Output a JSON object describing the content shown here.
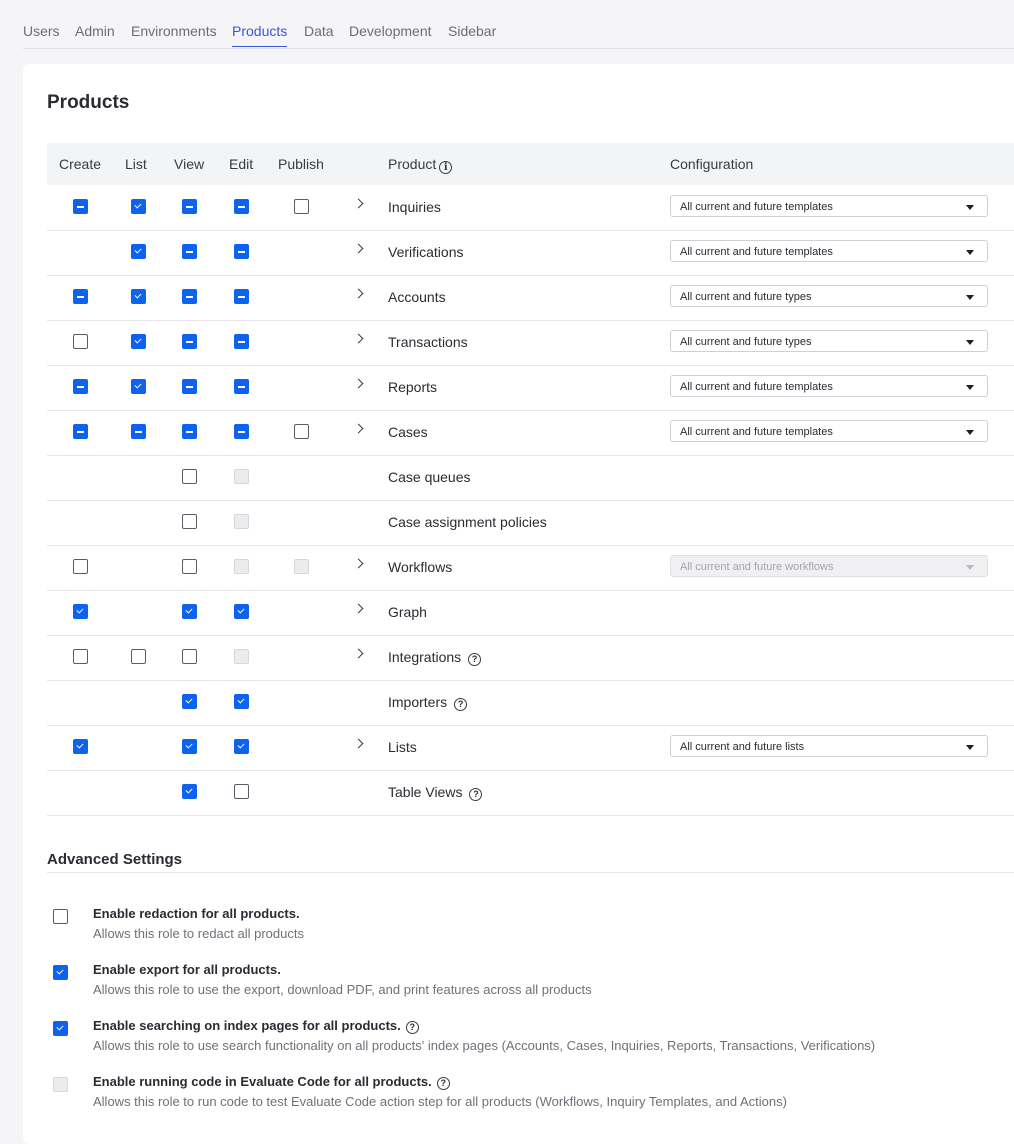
{
  "tabs": [
    "Users",
    "Admin",
    "Environments",
    "Products",
    "Data",
    "Development",
    "Sidebar"
  ],
  "active_tab": "Products",
  "page_title": "Products",
  "headers": {
    "create": "Create",
    "list": "List",
    "view": "View",
    "edit": "Edit",
    "publish": "Publish",
    "product": "Product",
    "configuration": "Configuration"
  },
  "colors": {
    "accent": "#0d62f0",
    "tab_active": "#3b55d9"
  },
  "rows": [
    {
      "name": "Inquiries",
      "create": "mixed",
      "list": "checked",
      "view": "mixed",
      "edit": "mixed",
      "publish": "unchecked",
      "expandable": true,
      "help": false,
      "config": "All current and future templates",
      "config_disabled": false
    },
    {
      "name": "Verifications",
      "create": "none",
      "list": "checked",
      "view": "mixed",
      "edit": "mixed",
      "publish": "none",
      "expandable": true,
      "help": false,
      "config": "All current and future templates",
      "config_disabled": false
    },
    {
      "name": "Accounts",
      "create": "mixed",
      "list": "checked",
      "view": "mixed",
      "edit": "mixed",
      "publish": "none",
      "expandable": true,
      "help": false,
      "config": "All current and future types",
      "config_disabled": false
    },
    {
      "name": "Transactions",
      "create": "unchecked",
      "list": "checked",
      "view": "mixed",
      "edit": "mixed",
      "publish": "none",
      "expandable": true,
      "help": false,
      "config": "All current and future types",
      "config_disabled": false
    },
    {
      "name": "Reports",
      "create": "mixed",
      "list": "checked",
      "view": "mixed",
      "edit": "mixed",
      "publish": "none",
      "expandable": true,
      "help": false,
      "config": "All current and future templates",
      "config_disabled": false
    },
    {
      "name": "Cases",
      "create": "mixed",
      "list": "mixed",
      "view": "mixed",
      "edit": "mixed",
      "publish": "unchecked",
      "expandable": true,
      "help": false,
      "config": "All current and future templates",
      "config_disabled": false
    },
    {
      "name": "Case queues",
      "create": "none",
      "list": "none",
      "view": "unchecked",
      "edit": "disabled",
      "publish": "none",
      "expandable": false,
      "help": false,
      "config": null,
      "config_disabled": false
    },
    {
      "name": "Case assignment policies",
      "create": "none",
      "list": "none",
      "view": "unchecked",
      "edit": "disabled",
      "publish": "none",
      "expandable": false,
      "help": false,
      "config": null,
      "config_disabled": false
    },
    {
      "name": "Workflows",
      "create": "unchecked",
      "list": "none",
      "view": "unchecked",
      "edit": "disabled",
      "publish": "disabled",
      "expandable": true,
      "help": false,
      "config": "All current and future workflows",
      "config_disabled": true
    },
    {
      "name": "Graph",
      "create": "checked",
      "list": "none",
      "view": "checked",
      "edit": "checked",
      "publish": "none",
      "expandable": true,
      "help": false,
      "config": null,
      "config_disabled": false
    },
    {
      "name": "Integrations",
      "create": "unchecked",
      "list": "unchecked",
      "view": "unchecked",
      "edit": "disabled",
      "publish": "none",
      "expandable": true,
      "help": true,
      "config": null,
      "config_disabled": false
    },
    {
      "name": "Importers",
      "create": "none",
      "list": "none",
      "view": "checked",
      "edit": "checked",
      "publish": "none",
      "expandable": false,
      "help": true,
      "config": null,
      "config_disabled": false
    },
    {
      "name": "Lists",
      "create": "checked",
      "list": "none",
      "view": "checked",
      "edit": "checked",
      "publish": "none",
      "expandable": true,
      "help": false,
      "config": "All current and future lists",
      "config_disabled": false
    },
    {
      "name": "Table Views",
      "create": "none",
      "list": "none",
      "view": "checked",
      "edit": "unchecked",
      "publish": "none",
      "expandable": false,
      "help": true,
      "config": null,
      "config_disabled": false
    }
  ],
  "advanced": {
    "title": "Advanced Settings",
    "settings": [
      {
        "title": "Enable redaction for all products.",
        "desc": "Allows this role to redact all products",
        "state": "unchecked",
        "help": false
      },
      {
        "title": "Enable export for all products.",
        "desc": "Allows this role to use the export, download PDF, and print features across all products",
        "state": "checked",
        "help": false
      },
      {
        "title": "Enable searching on index pages for all products.",
        "desc": "Allows this role to use search functionality on all products' index pages (Accounts, Cases, Inquiries, Reports, Transactions, Verifications)",
        "state": "checked",
        "help": true
      },
      {
        "title": "Enable running code in Evaluate Code for all products.",
        "desc": "Allows this role to run code to test Evaluate Code action step for all products (Workflows, Inquiry Templates, and Actions)",
        "state": "disabled",
        "help": true
      }
    ]
  }
}
